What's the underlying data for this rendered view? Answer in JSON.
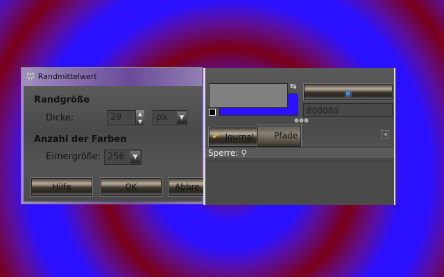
{
  "dialog": {
    "title": "Randmittelwert",
    "section1": "Randgröße",
    "thickness_label": "Dicke:",
    "thickness_value": "29",
    "unit": "px",
    "section2": "Anzahl der Farben",
    "bucket_label": "Eimergröße:",
    "bucket_value": "256",
    "help": "Hilfe",
    "ok": "OK",
    "cancel": "Abbre"
  },
  "panel": {
    "hex_value": "808080",
    "tab_journal": "Journal",
    "tab_paths": "Pfade",
    "lock_label": "Sperre:",
    "fg_color": "#808080",
    "bg_color": "#2a10ff"
  }
}
